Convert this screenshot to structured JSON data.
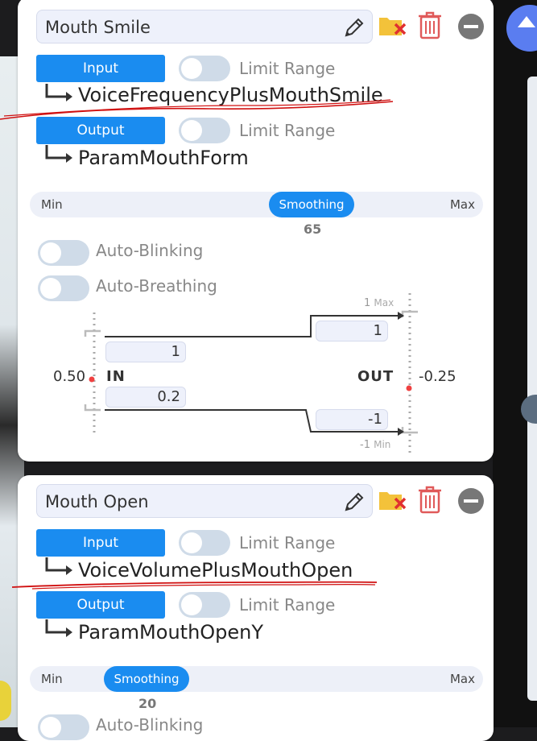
{
  "cards": [
    {
      "name": "Mouth Smile",
      "input_label": "Input",
      "input_param": "VoiceFrequencyPlusMouthSmile",
      "output_label": "Output",
      "output_param": "ParamMouthForm",
      "limit_range_label": "Limit Range",
      "slider": {
        "min_label": "Min",
        "max_label": "Max",
        "thumb_label": "Smoothing",
        "value": "65"
      },
      "auto_blinking": "Auto-Blinking",
      "auto_breathing": "Auto-Breathing",
      "range": {
        "in_label": "IN",
        "out_label": "OUT",
        "in_value": "0.50",
        "out_value": "-0.25",
        "in_max": "1",
        "in_min": "0.2",
        "out_max": "1",
        "out_min": "-1",
        "out_max_label": "1",
        "out_max_word": "Max",
        "out_min_label": "-1",
        "out_min_word": "Min"
      }
    },
    {
      "name": "Mouth Open",
      "input_label": "Input",
      "input_param": "VoiceVolumePlusMouthOpen",
      "output_label": "Output",
      "output_param": "ParamMouthOpenY",
      "limit_range_label": "Limit Range",
      "slider": {
        "min_label": "Min",
        "max_label": "Max",
        "thumb_label": "Smoothing",
        "value": "20"
      },
      "auto_blinking": "Auto-Blinking"
    }
  ],
  "colors": {
    "accent": "#1a8cf0",
    "annotation": "#d01010",
    "danger": "#e05a5a",
    "folder": "#f3c23a"
  }
}
